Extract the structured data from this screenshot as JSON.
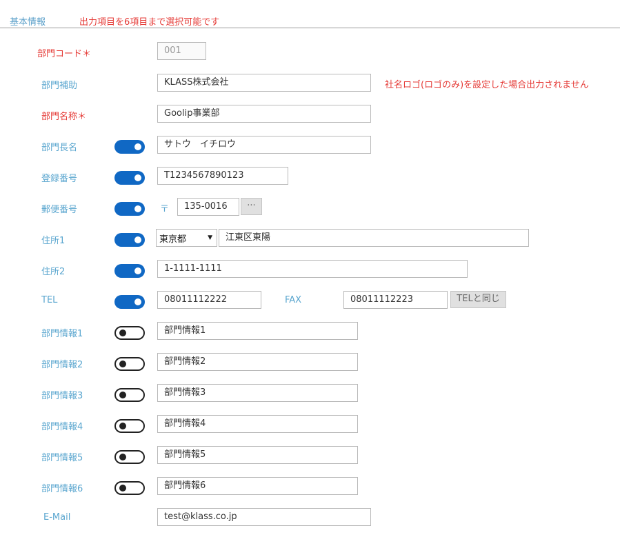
{
  "header": {
    "title": "基本情報",
    "note": "出力項目を6項目まで選択可能です"
  },
  "fields": {
    "dept_code": {
      "label": "部門コード＊",
      "value": "001"
    },
    "dept_assist": {
      "label": "部門補助",
      "value": "KLASS株式会社",
      "note": "社名ロゴ(ロゴのみ)を設定した場合出力されません"
    },
    "dept_name": {
      "label": "部門名称＊",
      "value": "Goolip事業部"
    },
    "dept_head": {
      "label": "部門長名",
      "value": "サトウ　イチロウ",
      "toggle": "on"
    },
    "reg_no": {
      "label": "登録番号",
      "value": "T1234567890123",
      "toggle": "on"
    },
    "postal": {
      "label": "郵便番号",
      "mark": "〒",
      "value": "135-0016",
      "button": "···",
      "toggle": "on"
    },
    "address1": {
      "label": "住所1",
      "prefecture": "東京都",
      "value": "江東区東陽",
      "toggle": "on"
    },
    "address2": {
      "label": "住所2",
      "value": "1-1111-1111",
      "toggle": "on"
    },
    "tel": {
      "label": "TEL",
      "value": "08011112222",
      "fax_label": "FAX",
      "fax_value": "08011112223",
      "same_button": "TELと同じ",
      "toggle": "on"
    },
    "info1": {
      "label": "部門情報1",
      "value": "部門情報1",
      "toggle": "off"
    },
    "info2": {
      "label": "部門情報2",
      "value": "部門情報2",
      "toggle": "off"
    },
    "info3": {
      "label": "部門情報3",
      "value": "部門情報3",
      "toggle": "off"
    },
    "info4": {
      "label": "部門情報4",
      "value": "部門情報4",
      "toggle": "off"
    },
    "info5": {
      "label": "部門情報5",
      "value": "部門情報5",
      "toggle": "off"
    },
    "info6": {
      "label": "部門情報6",
      "value": "部門情報6",
      "toggle": "off"
    },
    "email": {
      "label": "E-Mail",
      "value": "test@klass.co.jp"
    }
  },
  "colors": {
    "accent": "#1068c4",
    "label": "#5aa6cf",
    "required": "#e53935"
  }
}
